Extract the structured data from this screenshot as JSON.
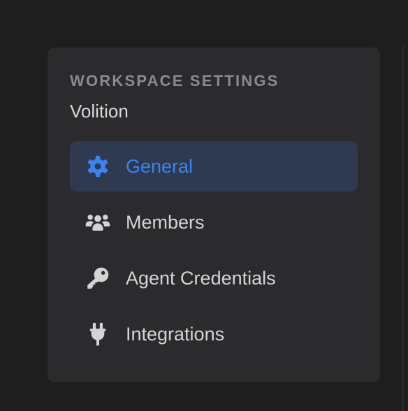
{
  "sidebar": {
    "heading": "WORKSPACE SETTINGS",
    "workspace_name": "Volition",
    "items": [
      {
        "label": "General",
        "icon": "gear-icon",
        "active": true
      },
      {
        "label": "Members",
        "icon": "users-icon",
        "active": false
      },
      {
        "label": "Agent Credentials",
        "icon": "key-icon",
        "active": false
      },
      {
        "label": "Integrations",
        "icon": "plug-icon",
        "active": false
      }
    ]
  },
  "colors": {
    "page_background": "#1e1e1f",
    "panel_background": "#2b2b2d",
    "active_background": "#2f3a50",
    "active_text": "#3d82f0",
    "text": "#d4d4d6",
    "heading_text": "#8b8b8e"
  }
}
